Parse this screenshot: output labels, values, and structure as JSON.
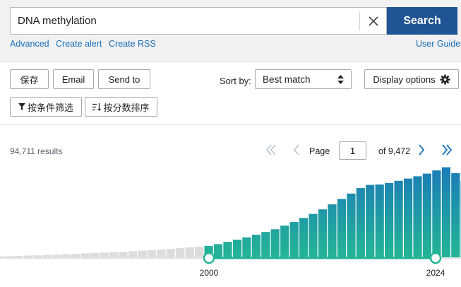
{
  "search": {
    "query": "DNA methylation",
    "button_label": "Search",
    "clear_icon": "close-icon"
  },
  "links": {
    "advanced": "Advanced",
    "create_alert": "Create alert",
    "create_rss": "Create RSS",
    "user_guide": "User Guide"
  },
  "toolbar": {
    "save": "保存",
    "email": "Email",
    "send_to": "Send to",
    "sort_label": "Sort by:",
    "sort_value": "Best match",
    "display_options": "Display options",
    "filter": "按条件筛选",
    "sort_fields": "按分数排序"
  },
  "results": {
    "count": "94,711 results"
  },
  "pagination": {
    "page_label": "Page",
    "current": "1",
    "of_label": "of 9,472"
  },
  "colors": {
    "accent": "#205493",
    "link": "#1a70b8",
    "bar_top": "#1d7fb8",
    "bar_bottom": "#22b395",
    "bar_grey": "#dcdcdc"
  },
  "chart_data": {
    "type": "bar",
    "x_range_labels": [
      "2000",
      "2024"
    ],
    "selection": {
      "start": "2000",
      "end": "2024"
    },
    "grey_bars_height": [
      1,
      1.3,
      1.6,
      1.9,
      2.2,
      2.6,
      3.0,
      3.4,
      3.8,
      4.2,
      4.7,
      5.2,
      5.7,
      6.2,
      6.8,
      7.4,
      8.0,
      8.7,
      9.4,
      10.1,
      11,
      11.8
    ],
    "selected_bars_height": [
      12.5,
      14.5,
      17,
      19.5,
      22,
      25,
      28,
      31,
      35,
      39,
      43.5,
      48,
      53,
      58.5,
      64.5,
      70.5,
      76.5,
      80,
      80.5,
      82,
      84.5,
      87,
      89.5,
      92.5,
      96,
      99.5,
      93,
      84.5,
      55
    ]
  }
}
